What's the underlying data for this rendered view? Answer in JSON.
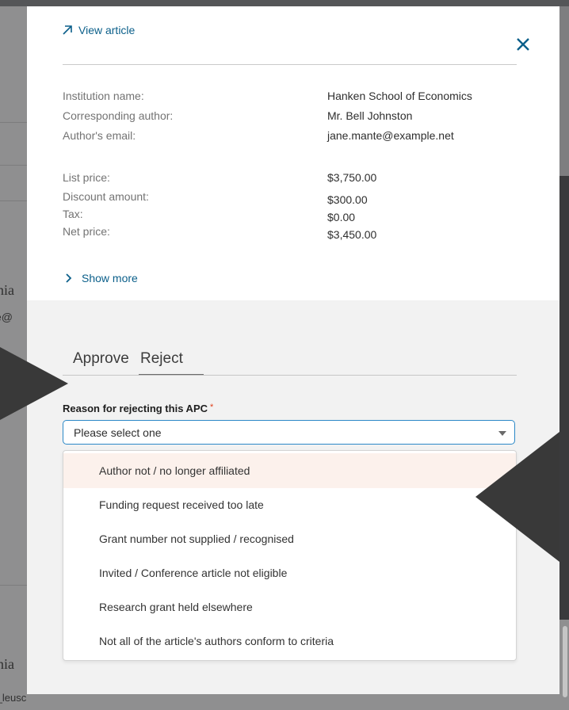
{
  "background": {
    "text_upper": "nia",
    "text_upper2": "e@",
    "text_lower": "nia",
    "email_fragment": "nne_leuschke@example.org"
  },
  "modal": {
    "view_article": "View article",
    "close_icon": "close-icon",
    "details": [
      {
        "label": "Institution name:",
        "value": "Hanken School of Economics"
      },
      {
        "label": "Corresponding author:",
        "value": "Mr. Bell Johnston"
      },
      {
        "label": "Author's email:",
        "value": "jane.mante@example.net"
      }
    ],
    "prices": [
      {
        "label": "List price:",
        "value": "$3,750.00"
      },
      {
        "label": "Discount amount:",
        "value": "$300.00"
      },
      {
        "label": "Tax:",
        "value": "$0.00"
      },
      {
        "label": "Net price:",
        "value": "$3,450.00"
      }
    ],
    "show_more": "Show more",
    "tabs": [
      {
        "label": "Approve"
      },
      {
        "label": "Reject"
      }
    ],
    "active_tab": "Reject",
    "reason_label": "Reason for rejecting this APC",
    "required_mark": "*",
    "select_placeholder": "Please select one",
    "options": [
      "Author not / no longer affiliated",
      "Funding request received too late",
      "Grant number not supplied / recognised",
      "Invited / Conference article not eligible",
      "Research grant held elsewhere",
      "Not all of the article's authors conform to criteria"
    ],
    "highlighted_option_index": 0
  },
  "colors": {
    "link": "#0b5f8a",
    "select_border": "#2b88c7",
    "required": "#e0401c",
    "highlight": "#fcf1ec"
  }
}
